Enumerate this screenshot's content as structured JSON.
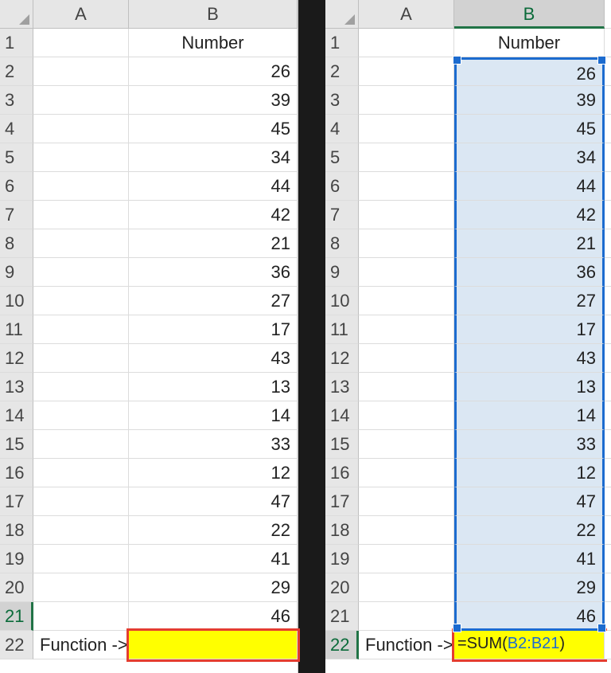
{
  "columns": {
    "A": "A",
    "B": "B"
  },
  "header_label": "Number",
  "values": [
    26,
    39,
    45,
    34,
    44,
    42,
    21,
    36,
    27,
    17,
    43,
    13,
    14,
    33,
    12,
    47,
    22,
    41,
    29,
    46
  ],
  "row22_label": "Function ->",
  "formula_prefix": "=SUM(",
  "formula_range": "B2:B21",
  "formula_suffix": ")",
  "row_count": 22
}
